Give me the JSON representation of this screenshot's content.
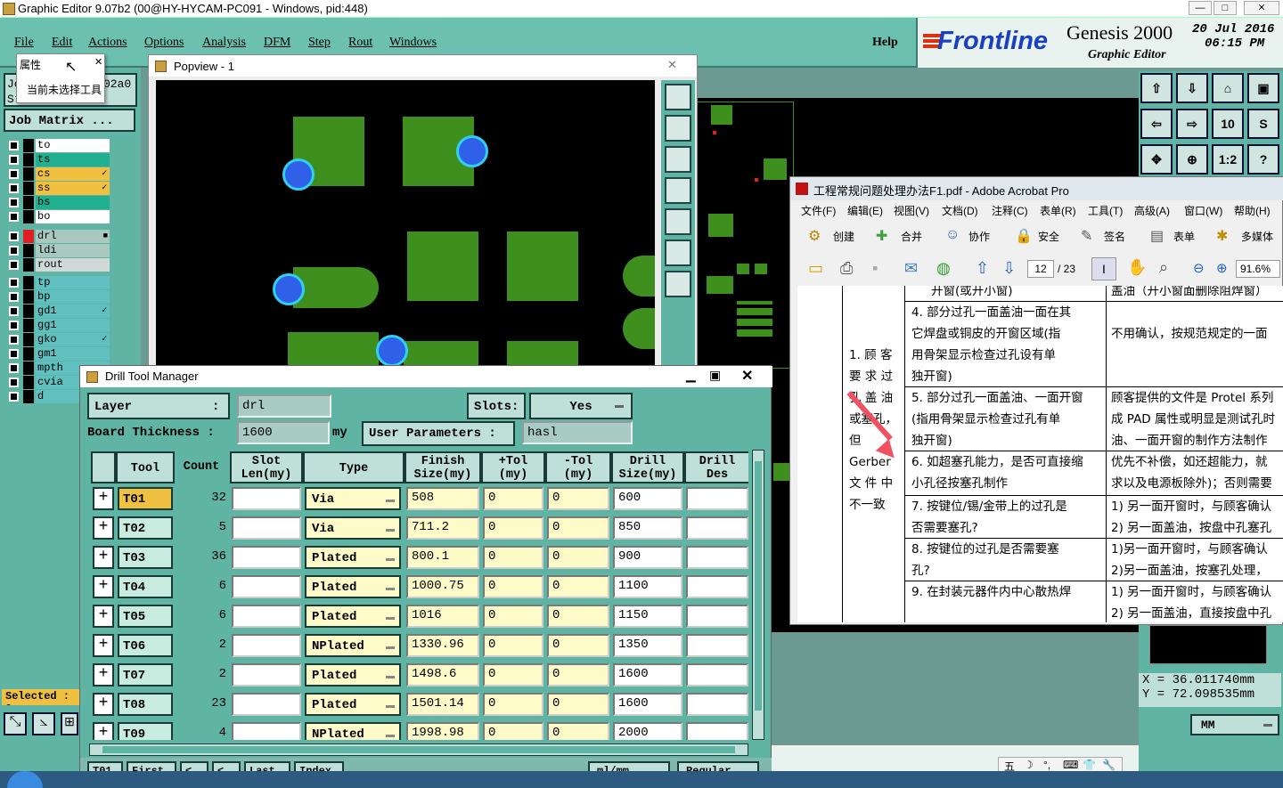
{
  "main_window": {
    "title": "Graphic Editor 9.07b2 (00@HY-HYCAM-PC091 - Windows, pid:448)",
    "controls": [
      "—",
      "□",
      "✕"
    ]
  },
  "menubar": {
    "items": [
      "File",
      "Edit",
      "Actions",
      "Options",
      "Analysis",
      "DFM",
      "Step",
      "Rout",
      "Windows"
    ],
    "help": "Help"
  },
  "brand": {
    "logo": "Frontline",
    "product": "Genesis 2000",
    "subtitle": "Graphic Editor",
    "date": "20 Jul 2016",
    "time": "06:15 PM"
  },
  "tooltip": {
    "title": "属性",
    "body": "当前未选择工具",
    "close": "✕"
  },
  "left_panel": {
    "job_label": "Jo",
    "step_label": "St",
    "job_value_tail": "02a0",
    "job_matrix": "Job Matrix ...",
    "layers": [
      {
        "name": "to",
        "color": "#ffffff",
        "swatch": "#000000"
      },
      {
        "name": "ts",
        "color": "#20b090",
        "swatch": "#000000"
      },
      {
        "name": "cs",
        "color": "#f0c040",
        "swatch": "#000000",
        "mark": "✓"
      },
      {
        "name": "ss",
        "color": "#f0c040",
        "swatch": "#000000",
        "mark": "✓"
      },
      {
        "name": "bs",
        "color": "#20b090",
        "swatch": "#000000"
      },
      {
        "name": "bo",
        "color": "#ffffff",
        "swatch": "#000000"
      },
      {
        "name": "drl",
        "color": "#a8c8c0",
        "swatch": "#e02020",
        "mark": "■"
      },
      {
        "name": "ldi",
        "color": "#a8c8c0",
        "swatch": "#000000"
      },
      {
        "name": "rout",
        "color": "#d0d8d8",
        "swatch": "#000000"
      },
      {
        "name": "tp",
        "color": "#60c0c0",
        "swatch": "#000000"
      },
      {
        "name": "bp",
        "color": "#60c0c0",
        "swatch": "#000000"
      },
      {
        "name": "gd1",
        "color": "#60c0c0",
        "swatch": "#000000",
        "mark": "✓"
      },
      {
        "name": "gg1",
        "color": "#60c0c0",
        "swatch": "#000000"
      },
      {
        "name": "gko",
        "color": "#60c0c0",
        "swatch": "#000000",
        "mark": "✓"
      },
      {
        "name": "gm1",
        "color": "#60c0c0",
        "swatch": "#000000"
      },
      {
        "name": "mpth",
        "color": "#60c0c0",
        "swatch": "#000000"
      },
      {
        "name": "cvia",
        "color": "#60c0c0",
        "swatch": "#000000"
      },
      {
        "name": "d",
        "color": "#60c0c0",
        "swatch": "#000000"
      }
    ],
    "selected_label": "Selected : 0"
  },
  "popview": {
    "title": "Popview - 1",
    "close": "✕"
  },
  "coords": {
    "x": "X  = 36.011740mm",
    "y": "Y  = 72.098535mm",
    "units": "MM"
  },
  "acrobat": {
    "title": "工程常规问题处理办法F1.pdf - Adobe Acrobat Pro",
    "menu": [
      "文件(F)",
      "编辑(E)",
      "视图(V)",
      "文档(D)",
      "注释(C)",
      "表单(R)",
      "工具(T)",
      "高级(A)",
      "窗口(W)",
      "帮助(H)"
    ],
    "toolbar": [
      "创建",
      "合并",
      "协作",
      "安全",
      "签名",
      "表单",
      "多媒体"
    ],
    "page_current": "12",
    "page_total": "/ 23",
    "zoom": "91.6%",
    "doc": {
      "top_row_left": "开窗(或开小窗)",
      "top_row_right": "盖油（开小窗面删除阻焊窗）",
      "left_col": [
        "1. 顾 客",
        "要 求 过",
        "孔 盖 油",
        "或塞孔，",
        "但",
        "Gerber",
        "文 件 中",
        "不一致"
      ],
      "rows": [
        {
          "mid": [
            "4.  部分过孔一面盖油一面在其",
            "它焊盘或铜皮的开窗区域(指",
            "用骨架显示检查过孔设有单",
            "独开窗)"
          ],
          "right": [
            "",
            "不用确认，按规范规定的一面"
          ]
        },
        {
          "mid": [
            "5.  部分过孔一面盖油、一面开窗",
            "(指用骨架显示检查过孔有单",
            "独开窗)"
          ],
          "right": [
            "顾客提供的文件是 Protel 系列",
            "成 PAD 属性或明显是测试孔时",
            "油、一面开窗的制作方法制作"
          ]
        },
        {
          "mid": [
            "6.  如超塞孔能力，是否可直接缩",
            "小孔径按塞孔制作"
          ],
          "right": [
            "优先不补偿，如还超能力，就",
            "求以及电源板除外)；否则需要"
          ]
        },
        {
          "mid": [
            "7.  按键位/锡/金带上的过孔是",
            "否需要塞孔?"
          ],
          "right": [
            "1) 另一面开窗时，与顾客确认",
            "2) 另一面盖油，按盘中孔塞孔"
          ]
        },
        {
          "mid": [
            "8.  按键位的过孔是否需要塞",
            "孔?"
          ],
          "right": [
            "1)另一面开窗时，与顾客确认",
            "2)另一面盖油，按塞孔处理，"
          ]
        },
        {
          "mid": [
            "9.  在封装元器件内中心散热焊"
          ],
          "right": [
            "1) 另一面开窗时，与顾客确认",
            "2) 另一面盖油，直接按盘中孔"
          ]
        }
      ]
    }
  },
  "drill_tool_manager": {
    "title": "Drill Tool Manager",
    "layer_label": "Layer",
    "layer_colon": ":",
    "layer_value": "drl",
    "slots_label": "Slots:",
    "slots_value": "Yes",
    "thickness_label": "Board Thickness :",
    "thickness_value": "1600",
    "thickness_unit": "my",
    "user_params_label": "User Parameters :",
    "user_params_value": "hasl",
    "columns": [
      "Tool",
      "Count",
      "Slot Len(my)",
      "Type",
      "Finish Size(my)",
      "+Tol (my)",
      "-Tol (my)",
      "Drill Size(my)",
      "Drill Des"
    ],
    "rows": [
      {
        "tool": "T01",
        "count": "32",
        "type": "Via",
        "finish": "508",
        "ptol": "0",
        "ntol": "0",
        "drill": "600"
      },
      {
        "tool": "T02",
        "count": "5",
        "type": "Via",
        "finish": "711.2",
        "ptol": "0",
        "ntol": "0",
        "drill": "850"
      },
      {
        "tool": "T03",
        "count": "36",
        "type": "Plated",
        "finish": "800.1",
        "ptol": "0",
        "ntol": "0",
        "drill": "900"
      },
      {
        "tool": "T04",
        "count": "6",
        "type": "Plated",
        "finish": "1000.75",
        "ptol": "0",
        "ntol": "0",
        "drill": "1100"
      },
      {
        "tool": "T05",
        "count": "6",
        "type": "Plated",
        "finish": "1016",
        "ptol": "0",
        "ntol": "0",
        "drill": "1150"
      },
      {
        "tool": "T06",
        "count": "2",
        "type": "NPlated",
        "finish": "1330.96",
        "ptol": "0",
        "ntol": "0",
        "drill": "1350"
      },
      {
        "tool": "T07",
        "count": "2",
        "type": "Plated",
        "finish": "1498.6",
        "ptol": "0",
        "ntol": "0",
        "drill": "1600"
      },
      {
        "tool": "T08",
        "count": "23",
        "type": "Plated",
        "finish": "1501.14",
        "ptol": "0",
        "ntol": "0",
        "drill": "1600"
      },
      {
        "tool": "T09",
        "count": "4",
        "type": "NPlated",
        "finish": "1998.98",
        "ptol": "0",
        "ntol": "0",
        "drill": "2000"
      }
    ],
    "bottom_buttons": [
      "T01",
      "First",
      "<",
      "<",
      "Last",
      "Index"
    ],
    "bottom_right": [
      "ml/mm",
      "Regular"
    ]
  },
  "tray": [
    "五",
    "☽",
    "°,",
    "⌨",
    "👕",
    "🔧"
  ]
}
